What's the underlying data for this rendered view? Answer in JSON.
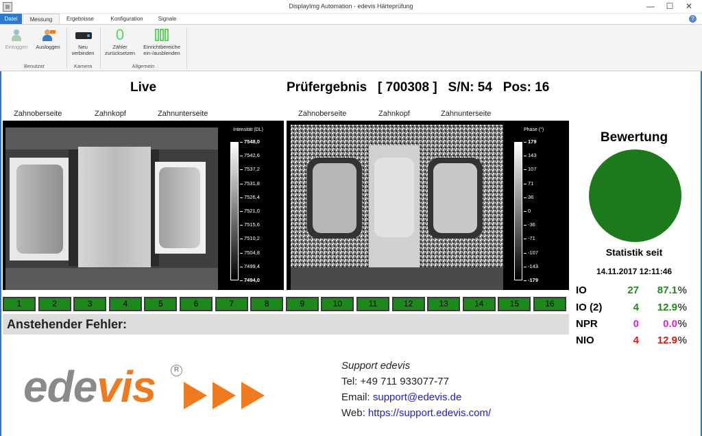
{
  "window": {
    "title": "DisplayImg Automation - edevis Härteprüfung",
    "minimize": "—",
    "maximize": "☐",
    "close": "✕"
  },
  "tabs": [
    "Datei",
    "Messung",
    "Ergebnisse",
    "Konfiguration",
    "Signale"
  ],
  "ribbon": {
    "buttons": [
      {
        "label": "Einloggen",
        "enabled": false
      },
      {
        "label": "Ausloggen",
        "enabled": true
      },
      {
        "label_1": "Neu",
        "label_2": "verbinden"
      },
      {
        "label_1": "Zähler",
        "label_2": "zurücksetzen"
      },
      {
        "label_1": "Einrichtbereiche",
        "label_2": "ein-/ausblenden"
      }
    ],
    "groups": [
      "Benutzer",
      "Kamera",
      "Allgemein"
    ],
    "counter_icon": "0"
  },
  "header": {
    "live": "Live",
    "result_label": "Prüfergebnis",
    "result_id": "[ 700308 ]",
    "sn_label": "S/N: 54",
    "pos_label": "Pos: 16"
  },
  "columns_left": [
    "Zahnoberseite",
    "Zahnkopf",
    "Zahnunterseite"
  ],
  "columns_right": [
    "Zahnoberseite",
    "Zahnkopf",
    "Zahnunterseite"
  ],
  "intensity_scale": {
    "title": "Intensität (DL)",
    "ticks": [
      "7548,0",
      "7542,6",
      "7537,2",
      "7531,8",
      "7526,4",
      "7521,0",
      "7515,6",
      "7510,2",
      "7504,8",
      "7499,4",
      "7494,0"
    ]
  },
  "phase_scale": {
    "title": "Phase (°)",
    "ticks": [
      "179",
      "143",
      "107",
      "71",
      "36",
      "0",
      "-36",
      "-71",
      "-107",
      "-143",
      "-179"
    ]
  },
  "positions": [
    "1",
    "2",
    "3",
    "4",
    "5",
    "6",
    "7",
    "8",
    "9",
    "10",
    "11",
    "12",
    "13",
    "14",
    "15",
    "16"
  ],
  "position_color": "#1b8a1b",
  "fehler": {
    "label": "Anstehender Fehler:"
  },
  "bewertung": {
    "title": "Bewertung",
    "status_color": "#1c7a1c",
    "stat_title": "Statistik seit",
    "stat_date": "14.11.2017 12:11:46",
    "rows": [
      {
        "label": "IO",
        "count": "27",
        "pct": "87.1",
        "color": "#1e8a1e"
      },
      {
        "label": "IO (2)",
        "count": "4",
        "pct": "12.9",
        "color": "#1e8a1e"
      },
      {
        "label": "NPR",
        "count": "0",
        "pct": "0.0",
        "color": "#e020e0"
      },
      {
        "label": "NIO",
        "count": "4",
        "pct": "12.9",
        "color": "#e01818"
      }
    ],
    "unit": "%"
  },
  "logo": {
    "part1": "ede",
    "part2": "vis",
    "registered": "R"
  },
  "support": {
    "title": "Support edevis",
    "tel": "Tel: +49 711 933077-77",
    "email_label": "Email:",
    "email": "support@edevis.de",
    "web_label": "Web:",
    "web": "https://support.edevis.com/"
  }
}
